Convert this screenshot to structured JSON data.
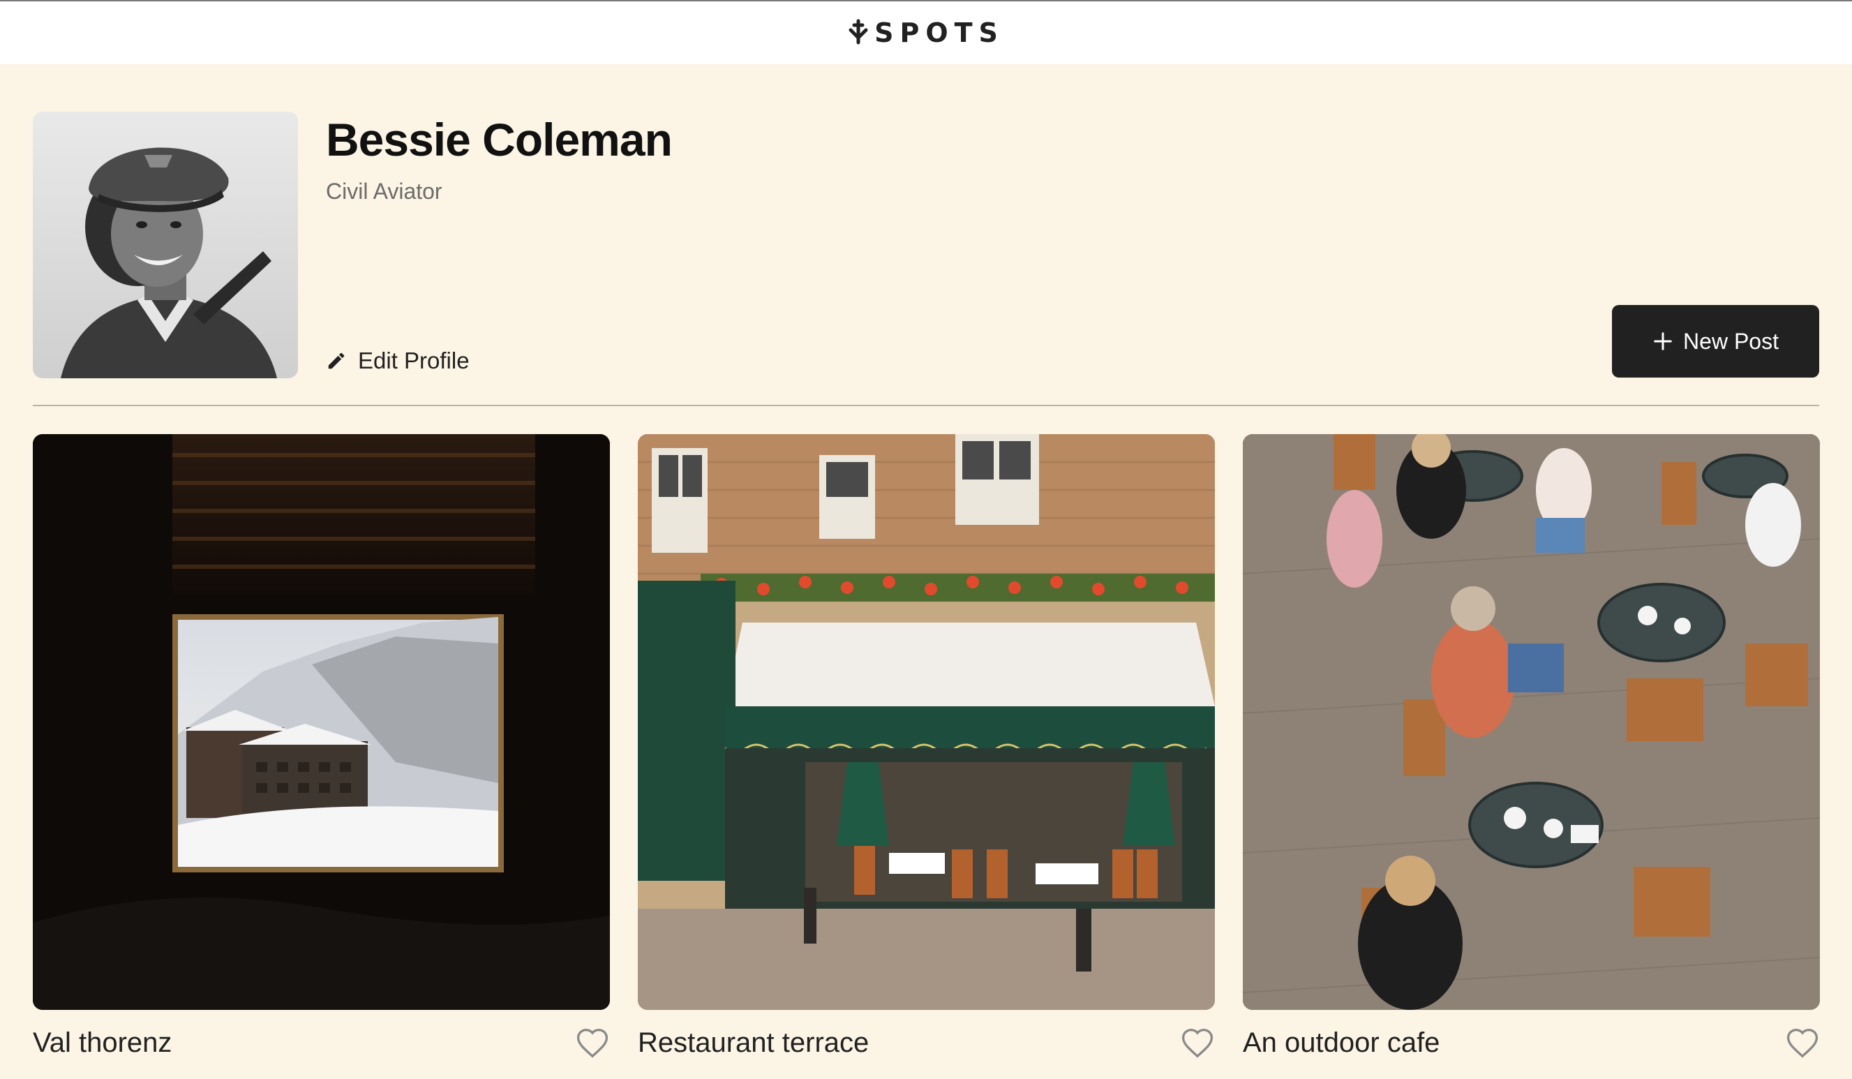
{
  "header": {
    "logo_text": "SPOTS",
    "logo_icon": "spots-logo-mark"
  },
  "profile": {
    "name": "Bessie Coleman",
    "description": "Civil Aviator",
    "edit_label": "Edit Profile",
    "edit_icon": "pencil-icon",
    "new_post_label": "New Post",
    "new_post_icon": "plus-icon"
  },
  "cards": [
    {
      "title": "Val thorenz",
      "liked": false,
      "like_icon": "heart-outline-icon"
    },
    {
      "title": "Restaurant terrace",
      "liked": false,
      "like_icon": "heart-outline-icon"
    },
    {
      "title": "An outdoor cafe",
      "liked": false,
      "like_icon": "heart-outline-icon"
    }
  ],
  "colors": {
    "page_background": "#fcf5e5",
    "header_background": "#ffffff",
    "text": "#212121",
    "secondary_text": "#6b6b6b",
    "button_background": "#212121",
    "button_text": "#ffffff",
    "heart_outline": "#8a8a8a",
    "divider": "#b8b2a6"
  }
}
